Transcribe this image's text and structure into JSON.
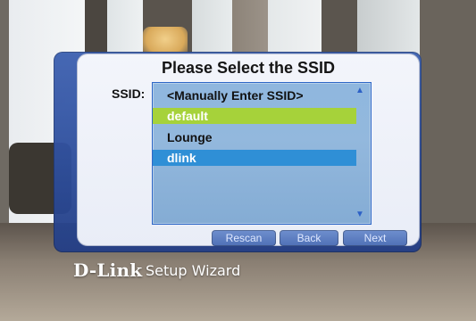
{
  "dialog": {
    "title": "Please Select the SSID",
    "ssid_label": "SSID:",
    "ssid_list": [
      "<Manually Enter SSID>",
      "default",
      "Lounge",
      "dlink"
    ],
    "selected_index": 3,
    "highlighted_index": 1
  },
  "buttons": {
    "rescan": "Rescan",
    "back": "Back",
    "next": "Next"
  },
  "brand": {
    "name": "D-Link",
    "product": "Setup Wizard"
  },
  "icons": {
    "scroll_up": "scroll-up-icon",
    "scroll_down": "scroll-down-icon"
  },
  "colors": {
    "highlight_green": "#a6d23a",
    "selection_blue": "#2f8fd6",
    "panel_blue": "#2f4f9d",
    "list_bg": "#8fb7de"
  }
}
